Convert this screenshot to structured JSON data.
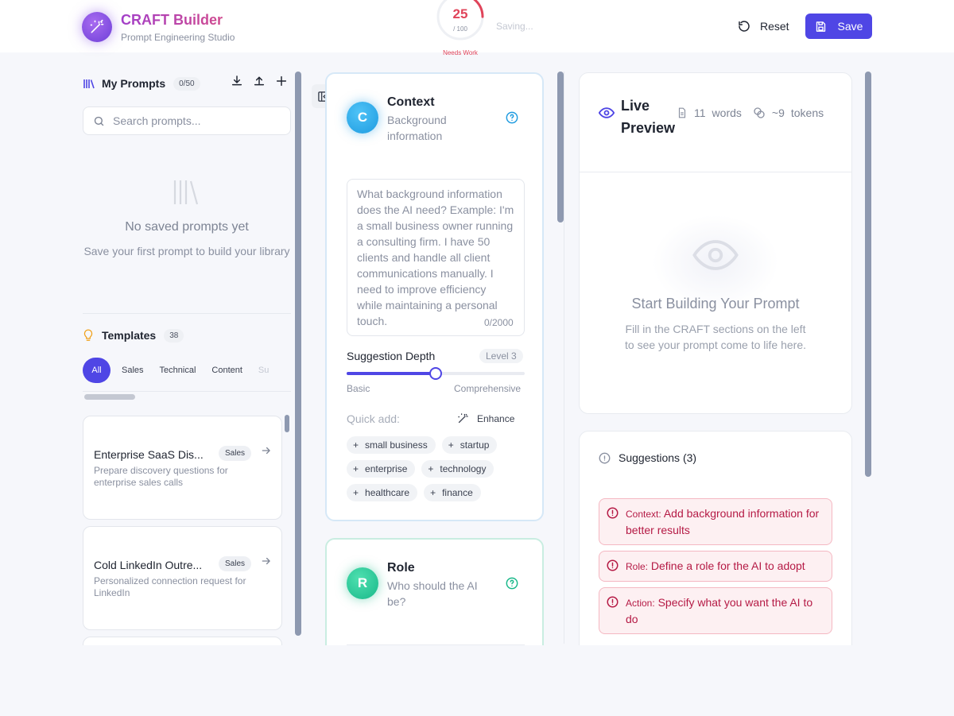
{
  "header": {
    "brand": "CRAFT Builder",
    "subtitle": "Prompt Engineering Studio",
    "score": "25",
    "score_total": "/ 100",
    "score_fraction": 0.25,
    "score_status": "Needs Work",
    "saving_text": "Saving...",
    "reset_label": "Reset",
    "save_label": "Save",
    "accent_color": "#4f46e5"
  },
  "library": {
    "title": "My Prompts",
    "count": "0/50",
    "search_placeholder": "Search prompts...",
    "empty_title": "No saved prompts yet",
    "empty_sub": "Save your first prompt to build your library"
  },
  "templates": {
    "title": "Templates",
    "count": "38",
    "categories": [
      "All",
      "Sales",
      "Technical",
      "Content",
      "Su"
    ],
    "items": [
      {
        "name": "Enterprise SaaS Dis...",
        "badge": "Sales",
        "desc": "Prepare discovery questions for enterprise sales calls"
      },
      {
        "name": "Cold LinkedIn Outre...",
        "badge": "Sales",
        "desc": "Personalized connection request for LinkedIn"
      }
    ]
  },
  "context": {
    "letter": "C",
    "title": "Context",
    "sub": "Background information",
    "placeholder": "What background information does the AI need?  Example: I'm a small business owner running a consulting firm. I have 50 clients and handle all client communications manually. I need to improve efficiency while maintaining a personal touch.",
    "char_count": "0/2000",
    "depth_label": "Suggestion Depth",
    "depth_level": "Level 3",
    "depth_fraction": 0.5,
    "depth_min": "Basic",
    "depth_max": "Comprehensive",
    "quick_add": "Quick add:",
    "enhance": "Enhance",
    "tags": [
      "small business",
      "startup",
      "enterprise",
      "technology",
      "healthcare",
      "finance"
    ]
  },
  "role": {
    "letter": "R",
    "title": "Role",
    "sub": "Who should the AI be?"
  },
  "preview": {
    "title": "Live Preview",
    "words": "11",
    "words_label": "words",
    "tokens": "~9",
    "tokens_label": "tokens",
    "heading": "Start Building Your Prompt",
    "sub": "Fill in the CRAFT sections on the left to see your prompt come to life here."
  },
  "suggestions": {
    "title": "Suggestions (3)",
    "items": [
      {
        "key": "Context:",
        "text": " Add background information for better results"
      },
      {
        "key": "Role:",
        "text": " Define a role for the AI to adopt"
      },
      {
        "key": "Action:",
        "text": " Specify what you want the AI to do"
      }
    ]
  }
}
